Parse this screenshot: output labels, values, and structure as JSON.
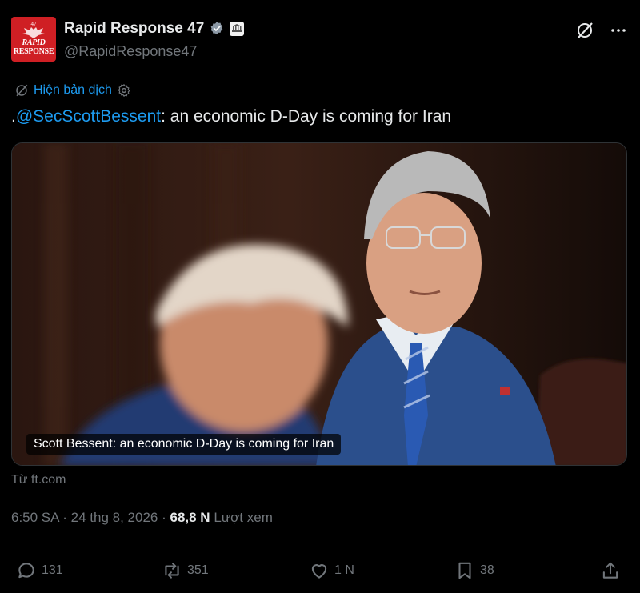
{
  "author": {
    "display_name": "Rapid Response 47",
    "handle": "@RapidResponse47",
    "avatar_text": {
      "top": "47",
      "line1": "RAPID",
      "line2": "RESPONSE"
    },
    "verified_color": "#8b98a5",
    "avatar_color": "#cf1f24"
  },
  "header_actions": {
    "grok_icon": "grok-slash-icon",
    "more_icon": "more-dots-icon"
  },
  "translate": {
    "label": "Hiện bản dịch",
    "icon": "translate-icon",
    "settings_icon": "gear-icon"
  },
  "tweet": {
    "prefix": ".",
    "mention": "@SecScottBessent",
    "text": ": an economic D-Day is coming for Iran"
  },
  "media": {
    "caption": "Scott Bessent: an economic D-Day is coming for Iran"
  },
  "source": "Từ ft.com",
  "meta": {
    "time": "6:50 SA",
    "sep": " · ",
    "date": "24 thg 8, 2026",
    "sep2": " · ",
    "views": "68,8 N",
    "views_label": "Lượt xem"
  },
  "actions": {
    "replies": "131",
    "reposts": "351",
    "likes": "1 N",
    "bookmarks": "38"
  },
  "colors": {
    "accent": "#1d9bf0",
    "muted": "#71767b",
    "text": "#e7e9ea",
    "bg": "#000000"
  }
}
